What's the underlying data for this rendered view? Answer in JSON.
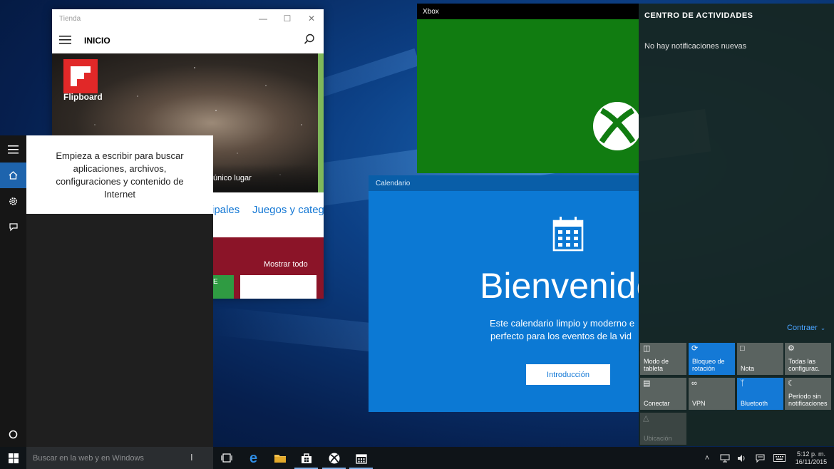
{
  "store": {
    "title": "Tienda",
    "app_heading": "INICIO",
    "hero_app": "Flipboard",
    "hero_caption": "único lugar",
    "tabs": [
      "ipales",
      "Juegos y categ"
    ],
    "show_all": "Mostrar todo",
    "tile_letter": "E"
  },
  "xbox": {
    "title": "Xbox"
  },
  "calendar": {
    "title": "Calendario",
    "welcome": "Bienvenido",
    "description": [
      "Este calendario limpio y moderno e",
      "perfecto para los eventos de la vid"
    ],
    "button": "Introducción"
  },
  "start": {
    "search_hint": "Empieza a escribir para buscar aplicaciones, archivos, configuraciones y contenido de Internet"
  },
  "action_center": {
    "title": "CENTRO DE ACTIVIDADES",
    "no_notifications": "No hay notificaciones nuevas",
    "collapse": "Contraer",
    "tiles": [
      {
        "label": "Modo de tableta",
        "icon": "tablet-mode-icon",
        "state": "off"
      },
      {
        "label": "Bloqueo de rotación",
        "icon": "rotation-lock-icon",
        "state": "on"
      },
      {
        "label": "Nota",
        "icon": "note-icon",
        "state": "off"
      },
      {
        "label": "Todas las configurac.",
        "icon": "gear-icon",
        "state": "off"
      },
      {
        "label": "Conectar",
        "icon": "connect-icon",
        "state": "off"
      },
      {
        "label": "VPN",
        "icon": "vpn-icon",
        "state": "on"
      },
      {
        "label": "Bluetooth",
        "icon": "bluetooth-icon",
        "state": "on"
      },
      {
        "label": "Período sin notificaciones",
        "icon": "moon-icon",
        "state": "off"
      },
      {
        "label": "Ubicación",
        "icon": "location-icon",
        "state": "disabled"
      }
    ]
  },
  "taskbar": {
    "search_placeholder": "Buscar en la web y en Windows",
    "time": "5:12 p. m.",
    "date": "16/11/2015"
  },
  "colors": {
    "accent": "#1479d6",
    "xbox_green": "#117c11",
    "calendar_blue": "#0c79d4",
    "store_band": "#8b1428"
  }
}
